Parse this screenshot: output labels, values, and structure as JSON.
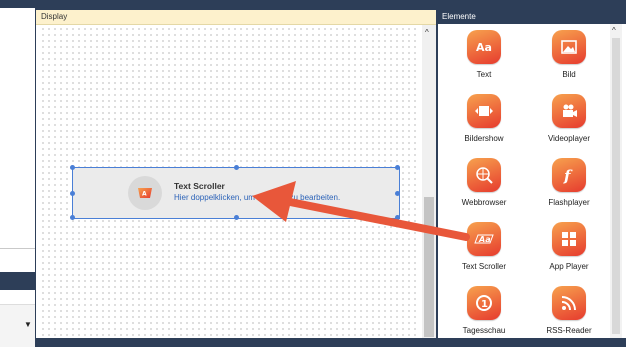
{
  "display_panel": {
    "title": "Display"
  },
  "text_scroller_widget": {
    "title": "Text Scroller",
    "hint": "Hier doppelklicken, um den Text zu bearbeiten."
  },
  "elements_panel": {
    "title": "Elemente",
    "items": [
      {
        "label": "Text",
        "icon": "text-aa-icon"
      },
      {
        "label": "Bild",
        "icon": "image-icon"
      },
      {
        "label": "Bildershow",
        "icon": "slideshow-icon"
      },
      {
        "label": "Videoplayer",
        "icon": "video-camera-icon"
      },
      {
        "label": "Webbrowser",
        "icon": "globe-search-icon"
      },
      {
        "label": "Flashplayer",
        "icon": "flash-icon"
      },
      {
        "label": "Text Scroller",
        "icon": "text-scroller-icon"
      },
      {
        "label": "App Player",
        "icon": "app-grid-icon"
      },
      {
        "label": "Tagesschau",
        "icon": "tagesschau-icon"
      },
      {
        "label": "RSS-Reader",
        "icon": "rss-icon"
      }
    ]
  },
  "colors": {
    "app_background": "#2d3e58",
    "display_header": "#fdf1cc",
    "selection": "#4a7fd6",
    "tile_gradient_start": "#f7a24e",
    "tile_gradient_end": "#e63b2e",
    "annotation_arrow": "#e8573a"
  }
}
